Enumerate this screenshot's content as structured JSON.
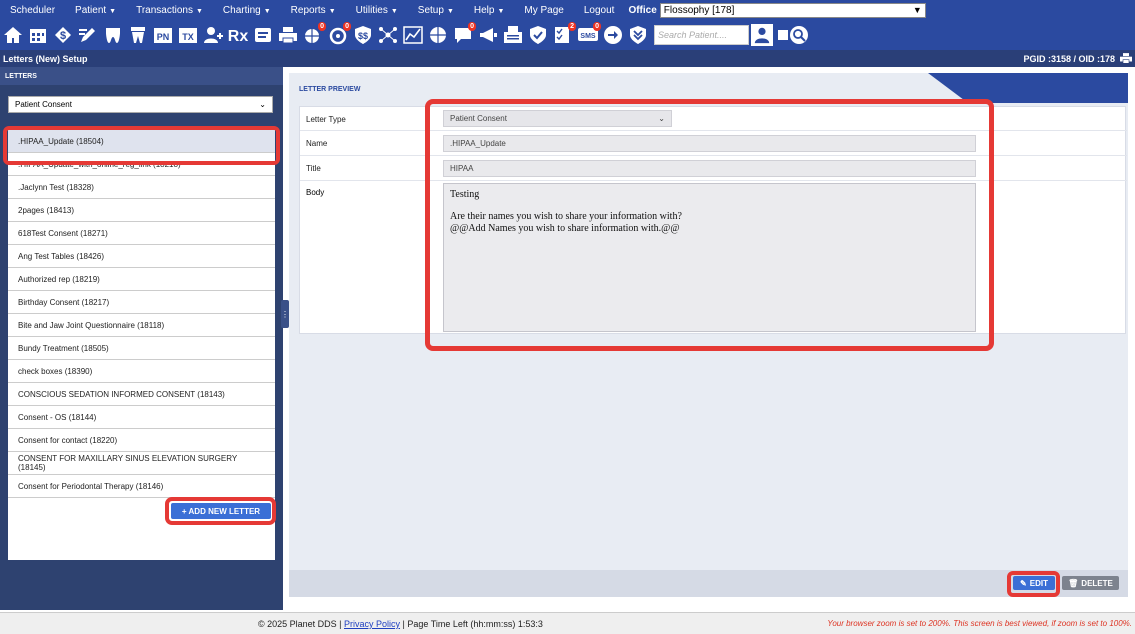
{
  "menu": {
    "items": [
      "Scheduler",
      "Patient",
      "Transactions",
      "Charting",
      "Reports",
      "Utilities",
      "Setup",
      "Help",
      "My Page",
      "Logout"
    ],
    "office_label": "Office",
    "office_value": "Flossophy [178]"
  },
  "toolbar": {
    "icons": [
      "home-icon",
      "calendar-icon",
      "dollar-icon",
      "pencil-icon",
      "tooth-icon",
      "tooth-alt-icon",
      "pn-icon",
      "tx-icon",
      "add-user-icon",
      "rx-icon",
      "document-icon",
      "printer-icon",
      "globe-icon",
      "recall-icon",
      "shield-dollar-icon",
      "network-icon",
      "chart-icon",
      "globe-message-icon",
      "message-icon",
      "megaphone-icon",
      "fax-icon",
      "shield-check-icon",
      "checklist-icon",
      "sms-icon",
      "arrow-right-icon",
      "chevron-down-double-icon"
    ],
    "pn": "PN",
    "tx": "TX",
    "rx": "Rx",
    "sms": "SMS",
    "badge_zero": "0",
    "badge_two": "2",
    "search_placeholder": "Search Patient...."
  },
  "titlebar": {
    "title": "Letters (New) Setup",
    "ids": "PGID :3158  /  OID :178"
  },
  "left": {
    "header": "LETTERS",
    "type_select": "Patient Consent",
    "letters": [
      ".HIPAA_Update (18504)",
      ".HIPAA_Update_with_online_reg_link (18218)",
      ".Jaclynn Test (18328)",
      "2pages (18413)",
      "618Test Consent (18271)",
      "Ang Test Tables (18426)",
      "Authorized rep (18219)",
      "Birthday Consent (18217)",
      "Bite and Jaw Joint Questionnaire (18118)",
      "Bundy Treatment (18505)",
      "check boxes (18390)",
      "CONSCIOUS SEDATION INFORMED CONSENT (18143)",
      "Consent - OS (18144)",
      "Consent for contact (18220)",
      "CONSENT FOR MAXILLARY SINUS ELEVATION SURGERY (18145)",
      "Consent for Periodontal Therapy (18146)"
    ],
    "add_button": "+ ADD NEW LETTER"
  },
  "preview": {
    "header": "LETTER PREVIEW",
    "letter_type_label": "Letter Type",
    "letter_type_value": "Patient Consent",
    "name_label": "Name",
    "name_value": ".HIPAA_Update",
    "title_label": "Title",
    "title_value": "HIPAA",
    "body_label": "Body",
    "body_line1": "Testing",
    "body_line2": "Are their names you wish to share your information with?",
    "body_line3": "@@Add Names you wish to share information with.@@",
    "edit_button": "EDIT",
    "delete_button": "DELETE"
  },
  "status": {
    "copyright": "© 2025 Planet DDS | ",
    "privacy": "Privacy Policy",
    "time_left": " | Page Time Left (hh:mm:ss) 1:53:3",
    "zoom_warning": "Your browser zoom is set to 200%. This screen is best viewed, if zoom is set to 100%."
  }
}
